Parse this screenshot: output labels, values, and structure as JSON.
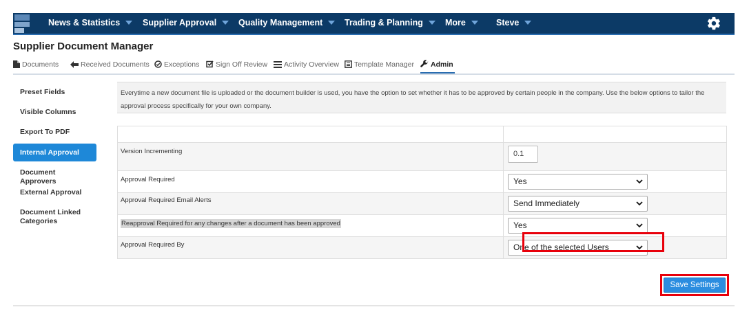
{
  "nav": {
    "items": [
      {
        "label": "News & Statistics"
      },
      {
        "label": "Supplier Approval"
      },
      {
        "label": "Quality Management"
      },
      {
        "label": "Trading & Planning"
      },
      {
        "label": "More"
      },
      {
        "label": "Steve"
      }
    ],
    "settings_icon": "gear-icon"
  },
  "page": {
    "title": "Supplier Document Manager"
  },
  "tabs": [
    {
      "label": "Documents",
      "icon": "document-icon"
    },
    {
      "label": "Received Documents",
      "icon": "arrow-left-icon"
    },
    {
      "label": "Exceptions",
      "icon": "circle-check-icon"
    },
    {
      "label": "Sign Off Review",
      "icon": "checkbox-icon"
    },
    {
      "label": "Activity Overview",
      "icon": "list-icon"
    },
    {
      "label": "Template Manager",
      "icon": "template-icon"
    },
    {
      "label": "Admin",
      "icon": "wrench-icon",
      "active": true
    }
  ],
  "sidebar": {
    "items": [
      {
        "label": "Preset Fields"
      },
      {
        "label": "Visible Columns"
      },
      {
        "label": "Export To PDF"
      },
      {
        "label": "Internal Approval",
        "active": true
      },
      {
        "label": "Document Approvers"
      },
      {
        "label": "External Approval"
      },
      {
        "label": "Document Linked Categories"
      }
    ]
  },
  "info": {
    "text": "Everytime a new document file is uploaded or the document builder is used, you have the option to set whether it has to be approved by certain people in the company. Use the below options to tailor the approval process specifically for your own company."
  },
  "settings": {
    "rows": [
      {
        "label": "Version Incrementing",
        "value": "0.1"
      },
      {
        "label": "Approval Required",
        "value": "Yes"
      },
      {
        "label": "Approval Required Email Alerts",
        "value": "Send Immediately"
      },
      {
        "label": "Reapproval Required for any changes after a document has been approved",
        "value": "Yes"
      },
      {
        "label": "Approval Required By",
        "value": "One of the selected Users"
      }
    ]
  },
  "actions": {
    "save_label": "Save Settings"
  },
  "colors": {
    "nav_bg": "#0c3a66",
    "accent": "#1e88d8",
    "highlight": "#e8000b"
  }
}
